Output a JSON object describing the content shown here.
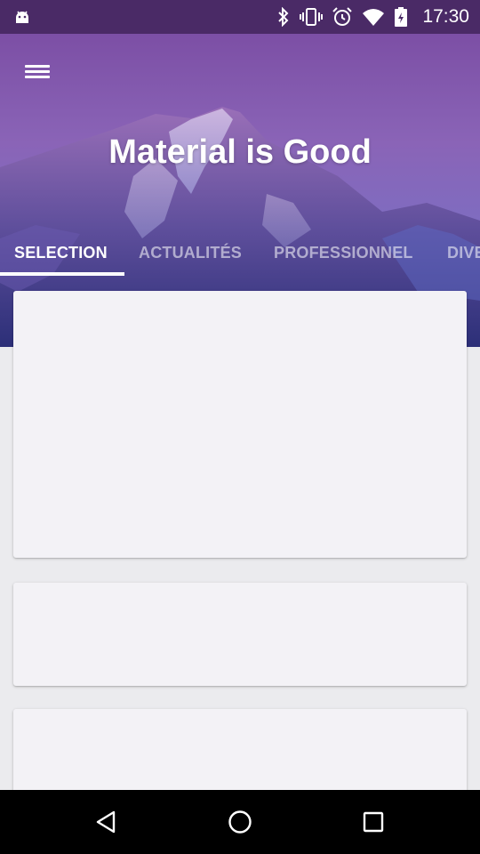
{
  "status_bar": {
    "time": "17:30",
    "icons": [
      "android-icon",
      "bluetooth-icon",
      "vibrate-icon",
      "alarm-icon",
      "wifi-icon",
      "battery-icon"
    ]
  },
  "header": {
    "title": "Material is Good",
    "menu_icon": "hamburger-menu-icon",
    "colors": {
      "sky_top": "#7c4fa5",
      "sky_bottom": "#3c3a8f",
      "mountain": "#4b3f86"
    }
  },
  "tabs": [
    {
      "label": "SELECTION",
      "selected": true
    },
    {
      "label": "ACTUALITÉS",
      "selected": false
    },
    {
      "label": "PROFESSIONNEL",
      "selected": false
    },
    {
      "label": "DIVERS",
      "selected": false
    }
  ],
  "cards": [
    {
      "id": "card-1"
    },
    {
      "id": "card-2"
    },
    {
      "id": "card-3"
    }
  ],
  "nav_bar": {
    "icons": [
      "back-icon",
      "home-icon",
      "recents-icon"
    ]
  },
  "colors": {
    "background": "#ebebee",
    "card": "#f3f2f6",
    "status_bar": "#4a2a66",
    "tab_active": "#ffffff",
    "tab_inactive": "rgba(255,255,255,0.55)"
  }
}
